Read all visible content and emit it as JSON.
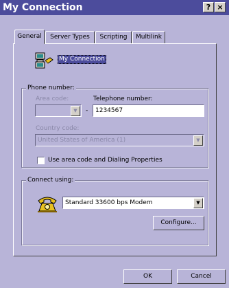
{
  "window": {
    "title": "My Connection",
    "help_button": "?",
    "close_button": "×"
  },
  "tabs": [
    {
      "label": "General",
      "active": true
    },
    {
      "label": "Server Types",
      "active": false
    },
    {
      "label": "Scripting",
      "active": false
    },
    {
      "label": "Multilink",
      "active": false
    }
  ],
  "connection": {
    "icon": "network-computer-icon",
    "name": "My Connection"
  },
  "phone": {
    "group_label": "Phone number:",
    "area_code_label": "Area code:",
    "area_code_value": "",
    "separator": "-",
    "telephone_label": "Telephone number:",
    "telephone_value": "1234567",
    "country_label": "Country code:",
    "country_value": "United States of America (1)",
    "use_area_code_label": "Use area code and Dialing Properties",
    "use_area_code_checked": false
  },
  "connect": {
    "group_label": "Connect using:",
    "icon": "telephone-modem-icon",
    "device_value": "Standard 33600 bps Modem",
    "configure_label": "Configure..."
  },
  "footer": {
    "ok_label": "OK",
    "cancel_label": "Cancel"
  },
  "colors": {
    "background": "#b8b4d8",
    "titlebar": "#4c4c9c",
    "selection": "#4c4c9c"
  }
}
